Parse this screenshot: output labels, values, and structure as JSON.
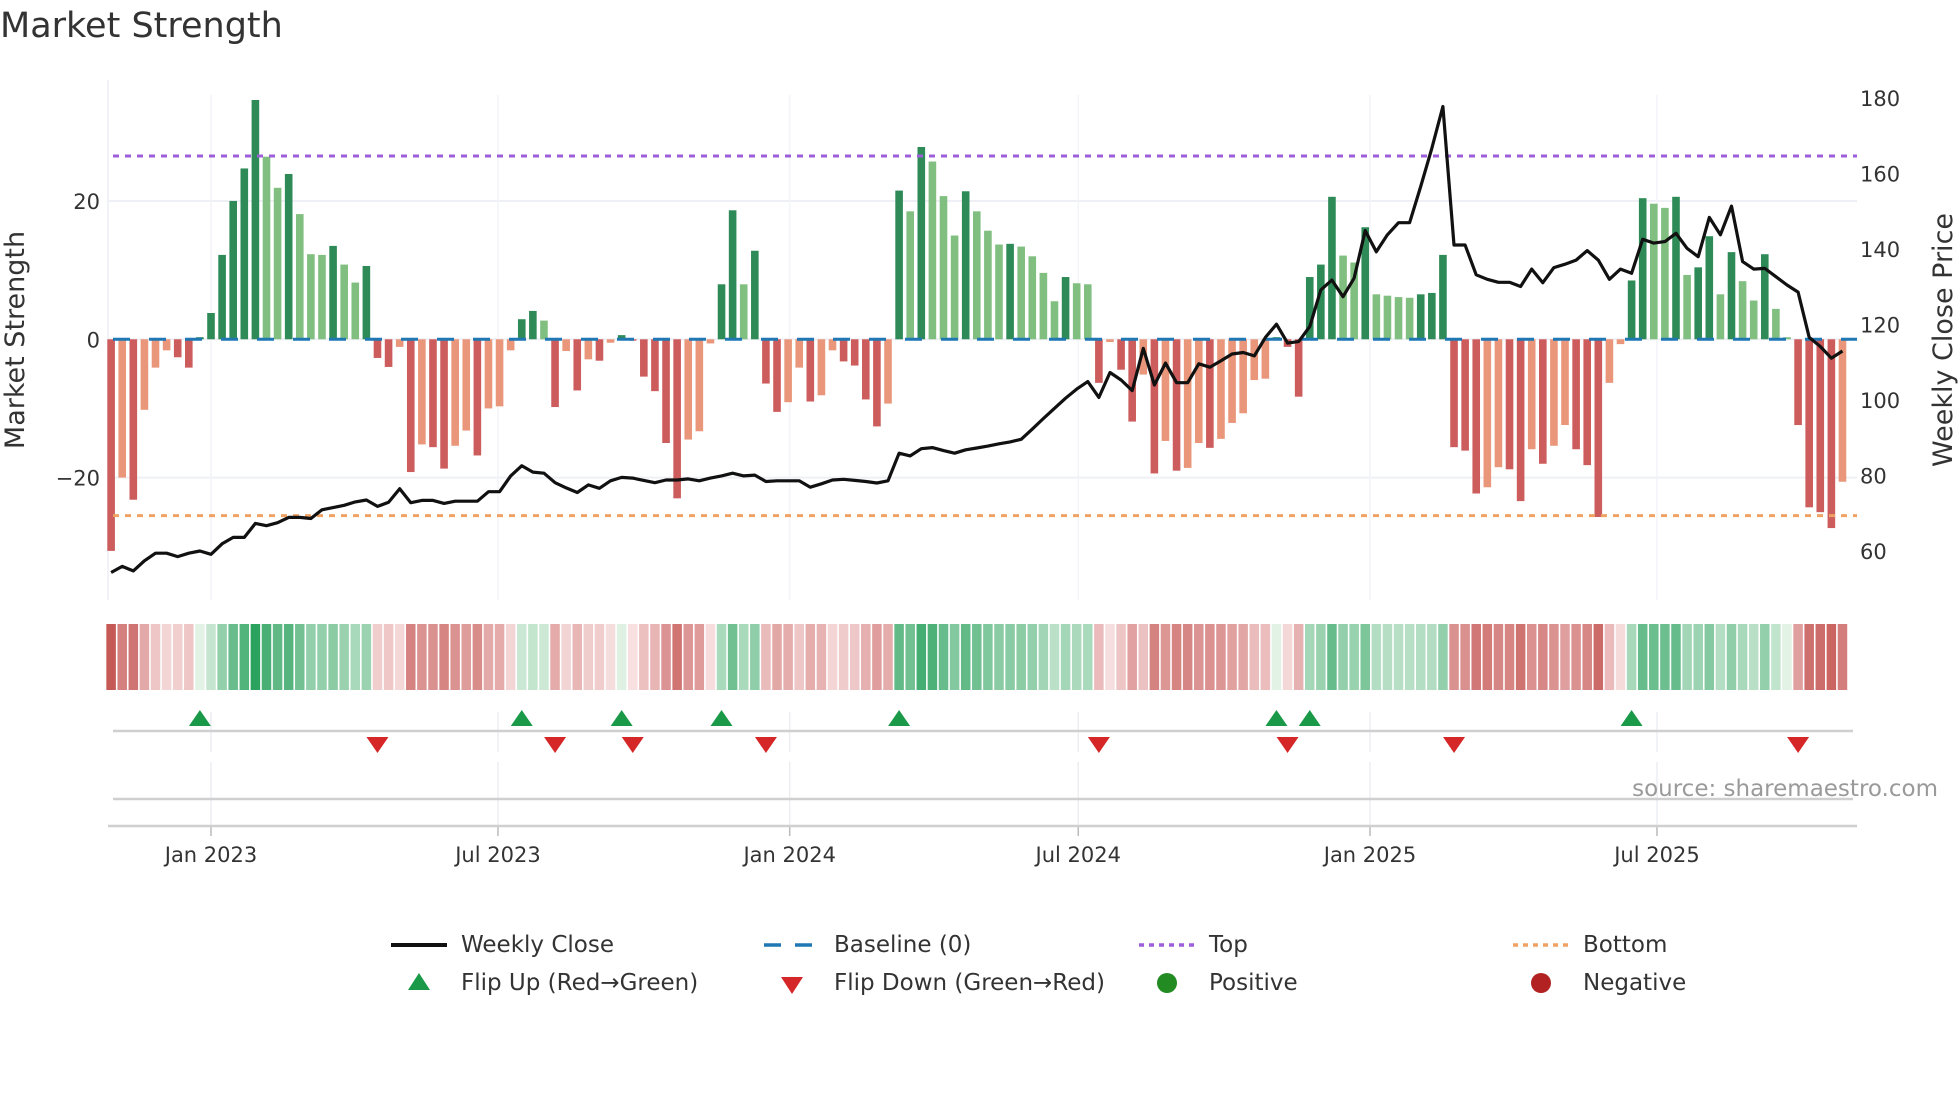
{
  "title": "Market Strength",
  "source": "source: sharemaestro.com",
  "chart_data": {
    "type": "bar+line",
    "title": "Market Strength",
    "ylabel_left": "Market Strength",
    "ylabel_right": "Weekly Close Price",
    "ylim_left": [
      -37.7,
      37.2
    ],
    "ylim_right": [
      47,
      184.3
    ],
    "left_ticks": [
      {
        "value": 20,
        "label": "20"
      },
      {
        "value": 0,
        "label": "0"
      },
      {
        "value": -20,
        "label": "−20"
      }
    ],
    "right_ticks": [
      {
        "value": 180,
        "label": "180"
      },
      {
        "value": 160,
        "label": "160"
      },
      {
        "value": 140,
        "label": "140"
      },
      {
        "value": 120,
        "label": "120"
      },
      {
        "value": 100,
        "label": "100"
      },
      {
        "value": 80,
        "label": "80"
      },
      {
        "value": 60,
        "label": "60"
      }
    ],
    "x_ticks": [
      {
        "date": "2023-01-01",
        "label": "Jan 2023"
      },
      {
        "date": "2023-07-01",
        "label": "Jul 2023"
      },
      {
        "date": "2024-01-01",
        "label": "Jan 2024"
      },
      {
        "date": "2024-07-01",
        "label": "Jul 2024"
      },
      {
        "date": "2025-01-01",
        "label": "Jan 2025"
      },
      {
        "date": "2025-07-01",
        "label": "Jul 2025"
      }
    ],
    "first_week": "2022-10-30",
    "frequency": "weekly",
    "top_level": 26.5,
    "bottom_level": -25.5,
    "baseline": 0,
    "strength": [
      -30.6,
      -20,
      -23.2,
      -10.2,
      -4.1,
      -1.6,
      -2.6,
      -4.1,
      0.3,
      3.8,
      12.2,
      20,
      24.7,
      34.6,
      26.4,
      21.9,
      23.9,
      18.1,
      12.3,
      12.2,
      13.5,
      10.8,
      8.2,
      10.6,
      -2.7,
      -4,
      -1.1,
      -19.2,
      -15.2,
      -15.6,
      -18.7,
      -15.4,
      -13.2,
      -16.8,
      -10,
      -9.7,
      -1.6,
      2.9,
      4.1,
      2.7,
      -9.8,
      -1.7,
      -7.4,
      -2.9,
      -3.1,
      -0.5,
      0.6,
      -0.2,
      -5.4,
      -7.5,
      -15,
      -23,
      -14.5,
      -13.3,
      -0.6,
      7.95,
      18.65,
      7.95,
      12.8,
      -6.4,
      -10.5,
      -9.1,
      -4.1,
      -9,
      -8.1,
      -1.6,
      -3.2,
      -3.8,
      -8.7,
      -12.6,
      -9.3,
      21.5,
      18.5,
      27.8,
      25.7,
      20.7,
      15,
      21.4,
      18.5,
      15.7,
      13.7,
      13.8,
      13.4,
      12,
      9.6,
      5.5,
      9,
      8.1,
      7.95,
      -6.3,
      -0.4,
      -4.4,
      -11.9,
      -5.1,
      -19.4,
      -14.7,
      -19,
      -18.6,
      -15,
      -15.7,
      -14.4,
      -12.1,
      -10.7,
      -5.9,
      -5.7,
      0.3,
      -1.1,
      -8.3,
      9,
      10.8,
      20.6,
      12.1,
      11.1,
      16.2,
      6.5,
      6.3,
      6.1,
      6,
      6.5,
      6.7,
      12.2,
      -15.6,
      -16.1,
      -22.3,
      -21.4,
      -18.5,
      -18.8,
      -23.4,
      -15.9,
      -18,
      -15.4,
      -12.4,
      -15.9,
      -18.2,
      -25.7,
      -6.3,
      -0.7,
      8.5,
      20.4,
      19.6,
      19,
      20.6,
      9.3,
      10.4,
      14.9,
      6.5,
      12.6,
      8.4,
      5.6,
      12.3,
      4.4,
      0.3,
      -12.4,
      -24.3,
      -25,
      -27.3,
      -20.6
    ],
    "weekly_close": [
      54.3,
      55.9,
      54.7,
      57.4,
      59.4,
      59.4,
      58.5,
      59.4,
      60,
      59.1,
      61.9,
      63.6,
      63.6,
      67.3,
      66.7,
      67.5,
      68.9,
      68.9,
      68.6,
      70.9,
      71.5,
      72.1,
      73,
      73.5,
      71.8,
      72.9,
      76.5,
      72.8,
      73.4,
      73.4,
      72.6,
      73.2,
      73.2,
      73.2,
      75.7,
      75.7,
      79.9,
      82.6,
      80.9,
      80.6,
      78.1,
      76.7,
      75.5,
      77.5,
      76.6,
      78.6,
      79.5,
      79.3,
      78.7,
      78.1,
      78.8,
      78.8,
      79.1,
      78.6,
      79.3,
      79.9,
      80.6,
      79.9,
      80.1,
      78.4,
      78.6,
      78.6,
      78.6,
      76.9,
      77.8,
      78.8,
      79,
      78.7,
      78.4,
      78,
      78.6,
      85.9,
      85.2,
      87.1,
      87.4,
      86.6,
      85.9,
      86.8,
      87.3,
      87.8,
      88.4,
      88.9,
      89.6,
      92.3,
      95.1,
      97.8,
      100.5,
      102.9,
      104.9,
      100.7,
      107.3,
      105.3,
      102.5,
      113.7,
      104,
      109.8,
      104.6,
      104.6,
      109.6,
      108.7,
      110.4,
      112.2,
      112.6,
      111.7,
      116.6,
      120.1,
      115.1,
      115.5,
      119.5,
      129.2,
      131.8,
      127.4,
      132.3,
      144.9,
      139.3,
      143.8,
      147,
      147,
      156.6,
      166.7,
      177.8,
      141.1,
      141.1,
      133.2,
      132,
      131.2,
      131.2,
      130.1,
      134.7,
      131.1,
      135.1,
      136,
      137.1,
      139.6,
      137.1,
      132,
      134.7,
      133.6,
      142.6,
      141.6,
      142,
      144.2,
      140.2,
      138,
      148.4,
      143.8,
      151.4,
      136.7,
      134.7,
      134.9,
      132.7,
      130.5,
      128.6,
      116.6,
      114.2,
      111.1,
      113
    ],
    "legend": {
      "placement": "bottom",
      "items": [
        {
          "label": "Weekly Close",
          "kind": "line"
        },
        {
          "label": "Baseline (0)",
          "kind": "dash"
        },
        {
          "label": "Top",
          "kind": "dot"
        },
        {
          "label": "Bottom",
          "kind": "dot"
        },
        {
          "label": "Flip Up (Red→Green)",
          "kind": "up"
        },
        {
          "label": "Flip Down (Green→Red)",
          "kind": "down"
        },
        {
          "label": "Positive",
          "kind": "circle"
        },
        {
          "label": "Negative",
          "kind": "circle"
        }
      ]
    },
    "colors": {
      "pos_rising": "#2e8b57",
      "pos_falling": "#80bf80",
      "neg_falling": "#cd5c5c",
      "neg_rising": "#e9967a",
      "baseline": "#1f77b4",
      "top": "#9d5fd9",
      "bottom": "#f0a264",
      "line": "#111111",
      "flip_up": "#1a9a48",
      "flip_down": "#d62728",
      "positive": "#228b22",
      "negative": "#b22222",
      "heat_pos": "#2ca25f",
      "heat_neg": "#c2504d"
    }
  }
}
